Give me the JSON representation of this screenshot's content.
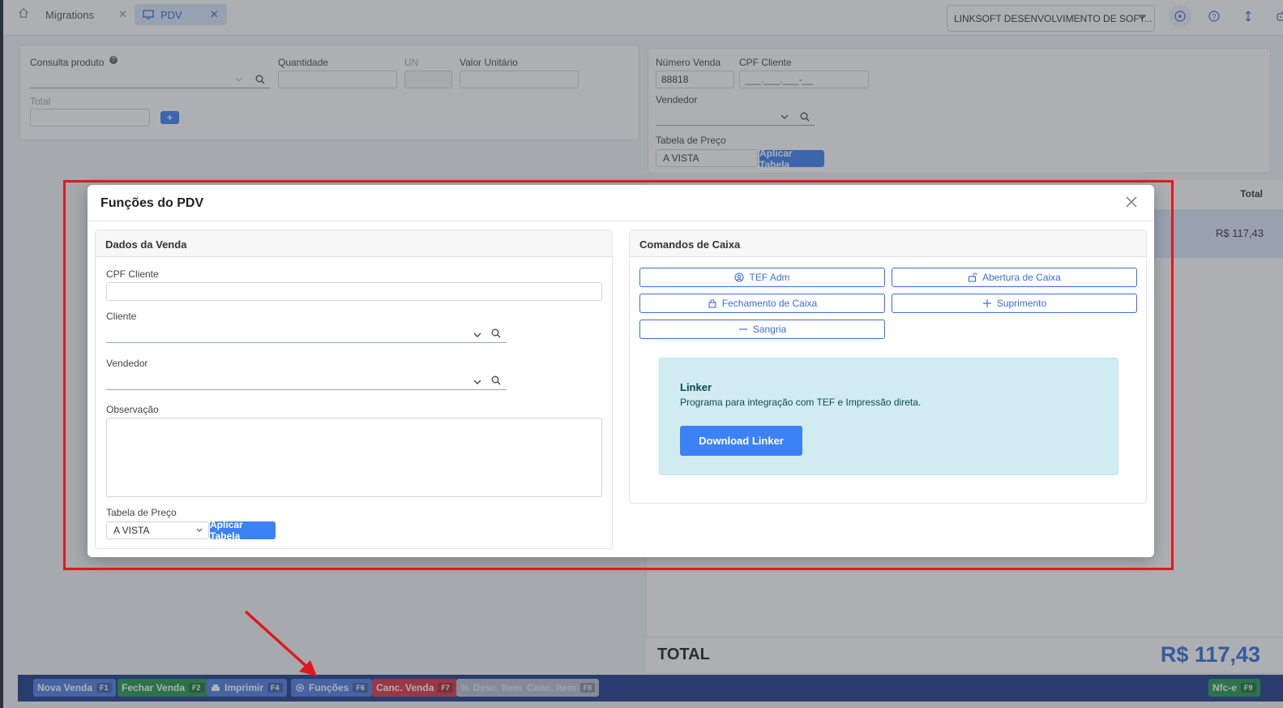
{
  "tabs": [
    {
      "label": "Migrations"
    },
    {
      "label": "PDV"
    }
  ],
  "company_select": "LINKSOFT DESENVOLVIMENTO DE SOFT...",
  "product_form": {
    "consulta_label": "Consulta produto",
    "quantidade_label": "Quantidade",
    "un_label": "UN",
    "valor_label": "Valor Unitário",
    "total_label": "Total",
    "add_label": "+"
  },
  "sale_form": {
    "numero_label": "Número Venda",
    "numero_value": "88818",
    "cpf_label": "CPF Cliente",
    "cpf_value": "___.___.___-__",
    "vendedor_label": "Vendedor",
    "tabela_label": "Tabela de Preço",
    "tabela_value": "A VISTA",
    "aplicar_label": "Aplicar Tabela"
  },
  "items_table": {
    "total_header": "Total",
    "row_total": "R$ 117,43"
  },
  "totals": {
    "label": "TOTAL",
    "value": "R$ 117,43"
  },
  "bottom_buttons": [
    {
      "label": "Nova Venda",
      "key": "F1"
    },
    {
      "label": "Fechar Venda",
      "key": "F2"
    },
    {
      "label": "Imprimir",
      "key": "F4"
    },
    {
      "label": "Funções",
      "key": "F6"
    },
    {
      "label": "Canc. Venda",
      "key": "F7"
    },
    {
      "label": "Desc. Item",
      "key": ""
    },
    {
      "label": "Canc. Item",
      "key": "F8"
    },
    {
      "label": "Nfc-e",
      "key": "F9"
    }
  ],
  "modal": {
    "title": "Funções do PDV",
    "dados": {
      "title": "Dados da Venda",
      "cpf_label": "CPF Cliente",
      "cliente_label": "Cliente",
      "vendedor_label": "Vendedor",
      "obs_label": "Observação",
      "tabela_label": "Tabela de Preço",
      "tabela_value": "A VISTA",
      "aplicar_label": "Aplicar Tabela"
    },
    "caixa": {
      "title": "Comandos de Caixa",
      "buttons": [
        {
          "label": "TEF Adm"
        },
        {
          "label": "Abertura de Caixa"
        },
        {
          "label": "Fechamento de Caixa"
        },
        {
          "label": "Suprimento"
        },
        {
          "label": "Sangria"
        }
      ],
      "linker_title": "Linker",
      "linker_text": "Programa para integração com TEF e Impressão direta.",
      "download_label": "Download Linker"
    }
  },
  "colors": {
    "accent": "#3b82f6",
    "highlight_box": "#e0191e",
    "bottom_bar": "#1e3a8a",
    "total_value": "#2f6fde"
  }
}
